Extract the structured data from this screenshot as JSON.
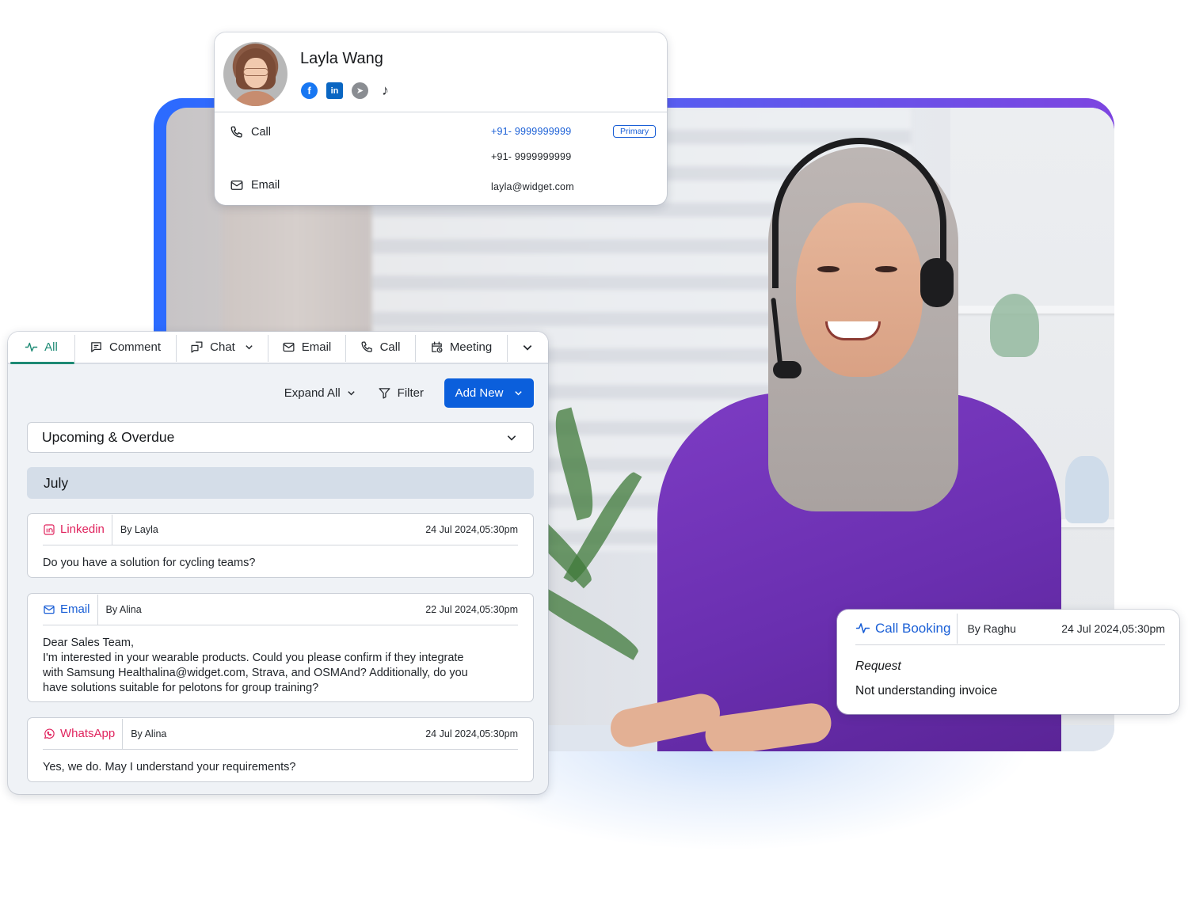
{
  "contact": {
    "name": "Layla Wang",
    "socials": [
      {
        "name": "facebook",
        "glyph": "f"
      },
      {
        "name": "linkedin",
        "glyph": "in"
      },
      {
        "name": "telegram",
        "glyph": "➤"
      },
      {
        "name": "tiktok",
        "glyph": "♪"
      }
    ],
    "call_label": "Call",
    "email_label": "Email",
    "phone_primary": "+91- 9999999999",
    "phone_secondary": "+91- 9999999999",
    "primary_badge": "Primary",
    "email_value": "layla@widget.com"
  },
  "panel": {
    "tabs": [
      {
        "label": "All",
        "icon": "activity-icon",
        "active": true
      },
      {
        "label": "Comment",
        "icon": "comment-icon"
      },
      {
        "label": "Chat",
        "icon": "chat-icon",
        "dropdown": true
      },
      {
        "label": "Email",
        "icon": "mail-icon"
      },
      {
        "label": "Call",
        "icon": "phone-icon"
      },
      {
        "label": "Meeting",
        "icon": "calendar-clock-icon"
      }
    ],
    "toolbar": {
      "expand_all": "Expand All",
      "filter": "Filter",
      "add_new": "Add New"
    },
    "filter_select": "Upcoming & Overdue",
    "month": "July",
    "entries": [
      {
        "source": "Linkedin",
        "by": "By Layla",
        "date": "24 Jul 2024,05:30pm",
        "body": "Do you have a solution for cycling teams?"
      },
      {
        "source": "Email",
        "by": "By Alina",
        "date": "22 Jul 2024,05:30pm",
        "body_lines": [
          "Dear Sales Team,",
          "I'm interested in your wearable products. Could you please confirm if they integrate",
          "with Samsung Healthalina@widget.com, Strava, and OSMAnd? Additionally, do you",
          "have solutions suitable for pelotons for group training?"
        ]
      },
      {
        "source": "WhatsApp",
        "by": "By Alina",
        "date": "24 Jul 2024,05:30pm",
        "body": "Yes, we do. May I understand your requirements?"
      }
    ]
  },
  "booking": {
    "source": "Call Booking",
    "by": "By Raghu",
    "date": "24 Jul 2024,05:30pm",
    "label": "Request",
    "text": "Not understanding invoice"
  },
  "colors": {
    "accent_blue": "#0b5fdc",
    "link_blue": "#1a5fd6",
    "active_tab_green": "#1d8a74",
    "source_pink": "#e0245e",
    "frame_gradient_start": "#2b6bff",
    "frame_gradient_end": "#7d45e0"
  }
}
